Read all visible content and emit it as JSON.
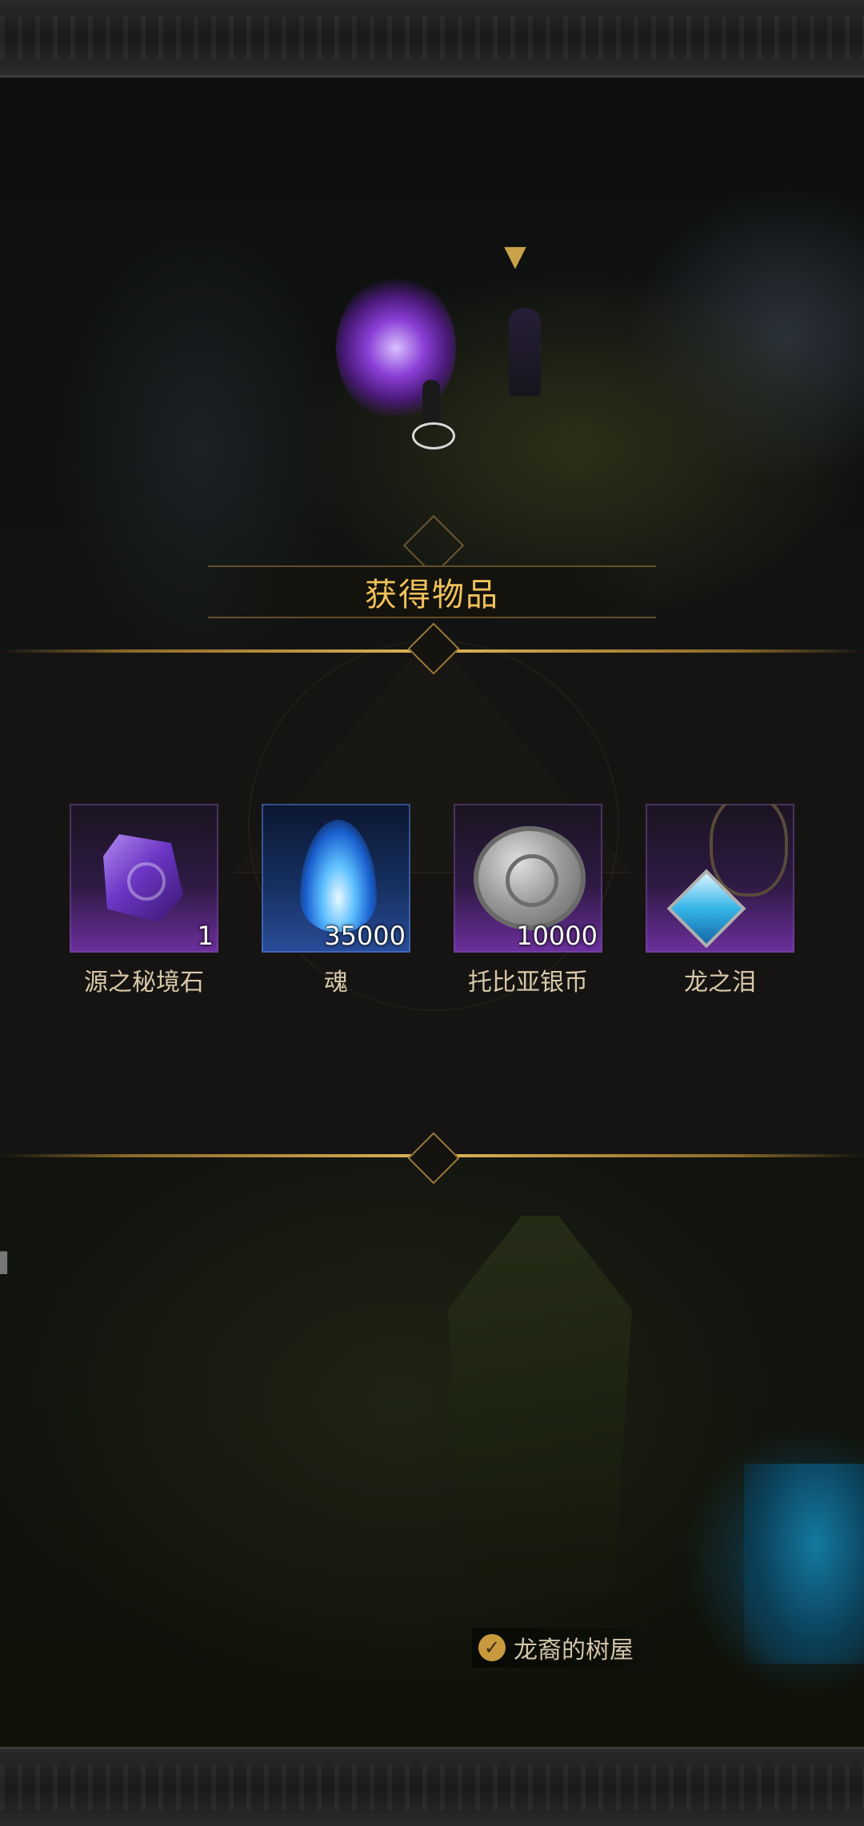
{
  "dialog": {
    "title": "获得物品"
  },
  "items": [
    {
      "name": "源之秘境石",
      "quantity": "1",
      "icon": "purple-gem-icon",
      "rarity_color": "#6d2f9e"
    },
    {
      "name": "魂",
      "quantity": "35000",
      "icon": "blue-soul-flame-icon",
      "rarity_color": "#2a4d9a"
    },
    {
      "name": "托比亚银币",
      "quantity": "10000",
      "icon": "silver-coin-icon",
      "rarity_color": "#6d2f9e"
    },
    {
      "name": "龙之泪",
      "quantity": "",
      "icon": "dragon-tear-pendant-icon",
      "rarity_color": "#6d2f9e"
    }
  ],
  "location": {
    "name": "龙裔的树屋",
    "icon": "quest-check-icon"
  },
  "theme": {
    "gold": "#f0c25a",
    "label": "#d9c8a8"
  }
}
